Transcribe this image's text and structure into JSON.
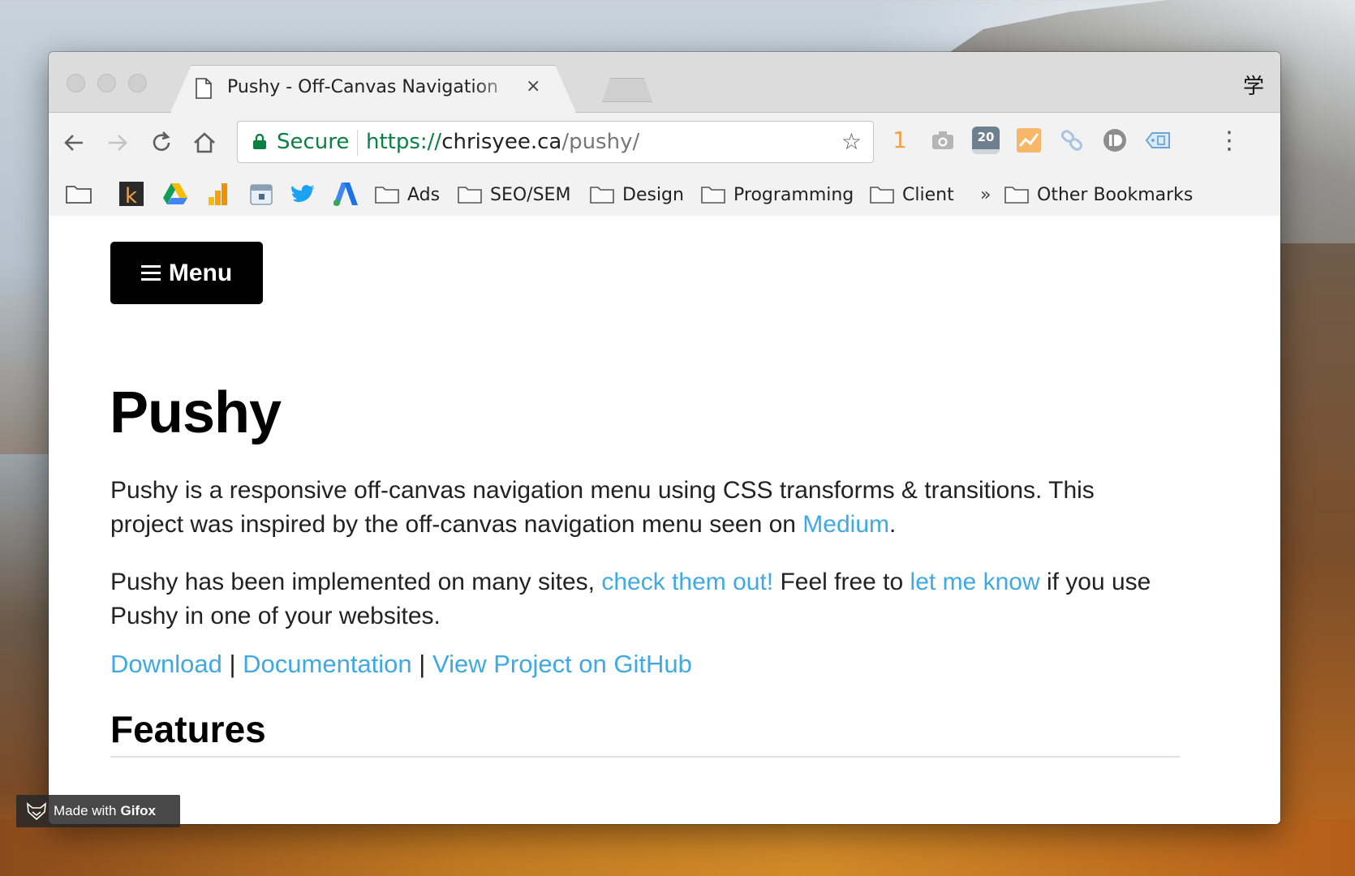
{
  "browser": {
    "tab_title": "Pushy - Off-Canvas Navigation",
    "tab_close": "×",
    "profile_glyph": "学",
    "url_secure_label": "Secure",
    "url_scheme": "https://",
    "url_host": "chrisyee.ca",
    "url_path": "/pushy/",
    "ext_badge_count": "1",
    "ext_calendar_date": "20",
    "bookmark_folders": [
      "Ads",
      "SEO/SEM",
      "Design",
      "Programming",
      "Client"
    ],
    "bookmarks_overflow": "»",
    "other_bookmarks": "Other Bookmarks"
  },
  "page": {
    "menu_label": "Menu",
    "title": "Pushy",
    "intro_text": "Pushy is a responsive off-canvas navigation menu using CSS transforms & transitions. This project was inspired by the off-canvas navigation menu seen on ",
    "intro_link": "Medium",
    "intro_end": ".",
    "sites_text_1": "Pushy has been implemented on many sites, ",
    "sites_link": "check them out!",
    "sites_text_2": " Feel free to ",
    "contact_link": "let me know",
    "sites_text_3": " if you use Pushy in one of your websites.",
    "link_download": "Download",
    "link_docs": "Documentation",
    "link_github": "View Project on GitHub",
    "link_separator": " | ",
    "features_heading": "Features"
  },
  "watermark": {
    "made_with": "Made with",
    "brand": "Gifox"
  },
  "colors": {
    "link": "#3fa9e6",
    "secure_green": "#0b8043",
    "menu_button_bg": "#000000"
  }
}
